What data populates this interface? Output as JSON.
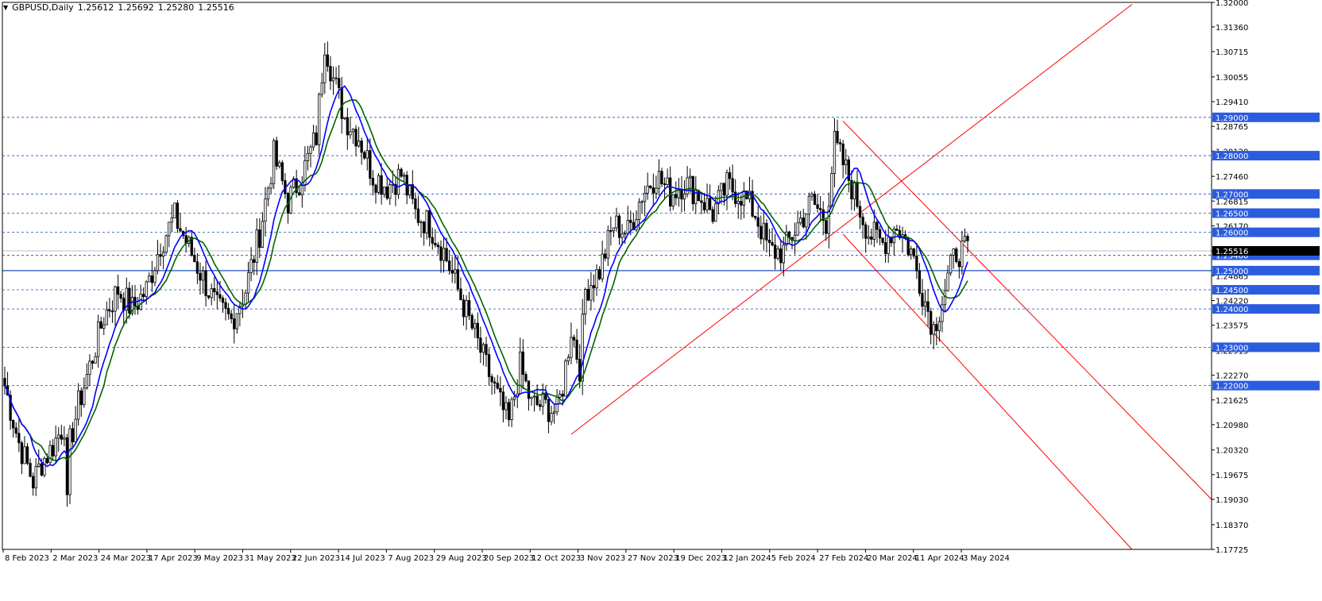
{
  "header": {
    "symbol": "GBPUSD,Daily",
    "open": "1.25612",
    "high": "1.25692",
    "low": "1.25280",
    "close": "1.25516"
  },
  "colors": {
    "background": "#ffffff",
    "candles": "#000000",
    "ma_fast": "#0000ff",
    "ma_slow": "#006400",
    "level_lines": "#1f4fbf",
    "level_label_bg": "#2b5ce0",
    "trend_lines": "#ff0000",
    "current_price_line": "#bfbfbf"
  },
  "chart_data": {
    "type": "candlestick",
    "title": "GBPUSD,Daily",
    "ylim": [
      1.17725,
      1.32
    ],
    "y_tick_labels": [
      "1.32000",
      "1.31360",
      "1.30715",
      "1.30055",
      "1.29410",
      "1.28765",
      "1.28120",
      "1.27460",
      "1.26815",
      "1.26170",
      "1.25516",
      "1.24865",
      "1.24220",
      "1.23575",
      "1.22915",
      "1.22270",
      "1.21625",
      "1.20980",
      "1.20320",
      "1.19675",
      "1.19030",
      "1.18370",
      "1.17725"
    ],
    "x_tick_labels": [
      "8 Feb 2023",
      "2 Mar 2023",
      "24 Mar 2023",
      "17 Apr 2023",
      "9 May 2023",
      "31 May 2023",
      "22 Jun 2023",
      "14 Jul 2023",
      "7 Aug 2023",
      "29 Aug 2023",
      "20 Sep 2023",
      "12 Oct 2023",
      "3 Nov 2023",
      "27 Nov 2023",
      "19 Dec 2023",
      "12 Jan 2024",
      "5 Feb 2024",
      "27 Feb 2024",
      "20 Mar 2024",
      "11 Apr 2024",
      "3 May 2024"
    ],
    "levels": [
      "1.29000",
      "1.28000",
      "1.27000",
      "1.26500",
      "1.26000",
      "1.25400",
      "1.25000",
      "1.24500",
      "1.24000",
      "1.23000",
      "1.22000"
    ],
    "current_price": "1.25516",
    "anchors": [
      [
        0,
        1.22
      ],
      [
        5,
        1.205
      ],
      [
        10,
        1.195
      ],
      [
        13,
        1.2
      ],
      [
        16,
        1.203
      ],
      [
        21,
        1.21
      ],
      [
        22,
        1.188
      ],
      [
        23,
        1.205
      ],
      [
        26,
        1.215
      ],
      [
        30,
        1.225
      ],
      [
        35,
        1.238
      ],
      [
        40,
        1.245
      ],
      [
        45,
        1.24
      ],
      [
        50,
        1.245
      ],
      [
        55,
        1.257
      ],
      [
        60,
        1.264
      ],
      [
        65,
        1.256
      ],
      [
        70,
        1.248
      ],
      [
        75,
        1.24
      ],
      [
        80,
        1.237
      ],
      [
        85,
        1.245
      ],
      [
        90,
        1.26
      ],
      [
        95,
        1.28
      ],
      [
        100,
        1.268
      ],
      [
        105,
        1.275
      ],
      [
        110,
        1.285
      ],
      [
        113,
        1.31
      ],
      [
        116,
        1.3
      ],
      [
        120,
        1.29
      ],
      [
        125,
        1.285
      ],
      [
        130,
        1.275
      ],
      [
        135,
        1.272
      ],
      [
        140,
        1.275
      ],
      [
        145,
        1.265
      ],
      [
        150,
        1.262
      ],
      [
        155,
        1.255
      ],
      [
        160,
        1.245
      ],
      [
        165,
        1.235
      ],
      [
        170,
        1.225
      ],
      [
        175,
        1.215
      ],
      [
        178,
        1.21
      ],
      [
        182,
        1.225
      ],
      [
        186,
        1.215
      ],
      [
        190,
        1.215
      ],
      [
        195,
        1.213
      ],
      [
        197,
        1.22
      ],
      [
        200,
        1.235
      ],
      [
        203,
        1.225
      ],
      [
        205,
        1.245
      ],
      [
        210,
        1.25
      ],
      [
        215,
        1.262
      ],
      [
        220,
        1.26
      ],
      [
        225,
        1.27
      ],
      [
        230,
        1.275
      ],
      [
        235,
        1.27
      ],
      [
        240,
        1.273
      ],
      [
        245,
        1.27
      ],
      [
        250,
        1.265
      ],
      [
        255,
        1.272
      ],
      [
        260,
        1.27
      ],
      [
        265,
        1.265
      ],
      [
        270,
        1.255
      ],
      [
        275,
        1.255
      ],
      [
        280,
        1.262
      ],
      [
        285,
        1.268
      ],
      [
        290,
        1.263
      ],
      [
        293,
        1.283
      ],
      [
        296,
        1.278
      ],
      [
        300,
        1.27
      ],
      [
        305,
        1.26
      ],
      [
        310,
        1.257
      ],
      [
        315,
        1.262
      ],
      [
        320,
        1.255
      ],
      [
        322,
        1.25
      ],
      [
        325,
        1.242
      ],
      [
        328,
        1.235
      ],
      [
        330,
        1.24
      ],
      [
        333,
        1.248
      ],
      [
        336,
        1.255
      ],
      [
        340,
        1.255
      ]
    ],
    "series": [
      {
        "name": "",
        "type": "candlestick"
      },
      {
        "name": "",
        "type": "moving-average-fast"
      },
      {
        "name": "",
        "type": "moving-average-slow"
      }
    ],
    "trend_lines": [
      {
        "from": [
          "12 Oct 2023",
          1.2073
        ],
        "to": [
          "after 3 May 2024",
          1.3195
        ]
      },
      {
        "from": [
          "27 Feb 2024",
          1.289
        ],
        "to": [
          "after 3 May 2024",
          1.1903
        ]
      },
      {
        "from": [
          "27 Feb 2024",
          1.2595
        ],
        "to": [
          "after 3 May 2024",
          1.1772
        ]
      }
    ]
  }
}
